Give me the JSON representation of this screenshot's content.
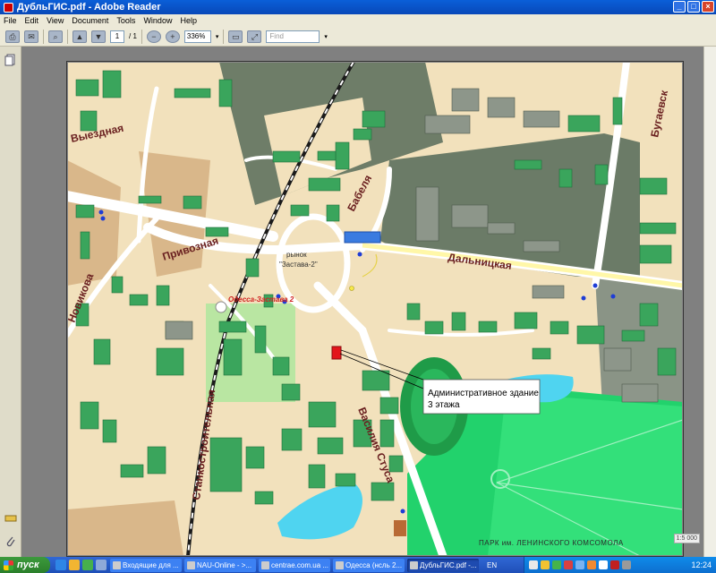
{
  "window": {
    "title": "ДубльГИС.pdf - Adobe Reader",
    "buttons": {
      "minimize": "_",
      "maximize": "□",
      "close": "×"
    }
  },
  "menu": [
    "File",
    "Edit",
    "View",
    "Document",
    "Tools",
    "Window",
    "Help"
  ],
  "toolbar": {
    "page_current": "1",
    "page_total": "/ 1",
    "zoom": "336%",
    "find_placeholder": "Find"
  },
  "map": {
    "streets": {
      "vyezdnaya": "Выездная",
      "privoznaya": "Привозная",
      "novikova": "Новикова",
      "stankostroitelnaya": "Станкостроительная",
      "babelya": "Бабеля",
      "dalnitskaya": "Дальницкая",
      "bugaevskaya": "Бугаевск",
      "vasiliya_stusa": "Василия Стуса"
    },
    "market_label_1": "рынок",
    "market_label_2": "\"Застава-2\"",
    "station_label": "Одесса-Застава 2",
    "park_label": "ПАРК им. ЛЕНИНСКОГО КОМСОМОЛА",
    "callout_line1": "Административное здание",
    "callout_line2": "3 этажа",
    "scale_label": "1:5 000",
    "colors": {
      "land": "#f2e1bc",
      "building": "#3aa55c",
      "industrial": "#6f7f6a",
      "park": "#1fd36a",
      "water": "#4fd4f0",
      "road": "#ffffff",
      "target": "#e3161b"
    }
  },
  "taskbar": {
    "start": "пуск",
    "items": [
      {
        "label": "Входящие для ..."
      },
      {
        "label": "NAU-Online - >..."
      },
      {
        "label": "centrae.com.ua ..."
      },
      {
        "label": "Одесса (нсль 2..."
      },
      {
        "label": "ДубльГИС.pdf -..."
      }
    ],
    "lang": "EN",
    "clock": "12:24"
  }
}
